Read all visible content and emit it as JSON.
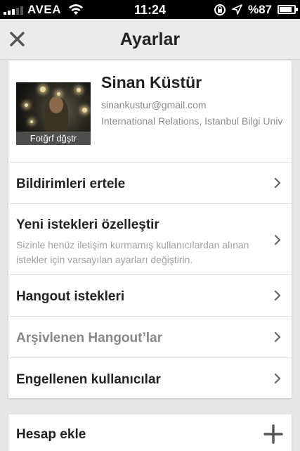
{
  "status_bar": {
    "carrier": "AVEA",
    "time": "11:24",
    "battery": "%87",
    "battery_level": 0.87
  },
  "nav": {
    "title": "Ayarlar"
  },
  "profile": {
    "name": "Sinan Küstür",
    "email": "sinankustur@gmail.com",
    "school": "International Relations, Istanbul Bilgi Univ",
    "photo_caption": "Fotğrf dğştr"
  },
  "settings": {
    "items": [
      {
        "label": "Bildirimleri ertele"
      },
      {
        "label": "Yeni istekleri özelleştir",
        "description": "Sizinle henüz iletişim kurmamış kullanıcılardan alınan istekler için varsayılan ayarları değiştirin."
      },
      {
        "label": "Hangout istekleri"
      },
      {
        "label": "Arşivlenen Hangout’lar"
      },
      {
        "label": "Engellenen kullanıcılar"
      }
    ]
  },
  "account": {
    "add_label": "Hesap ekle"
  }
}
